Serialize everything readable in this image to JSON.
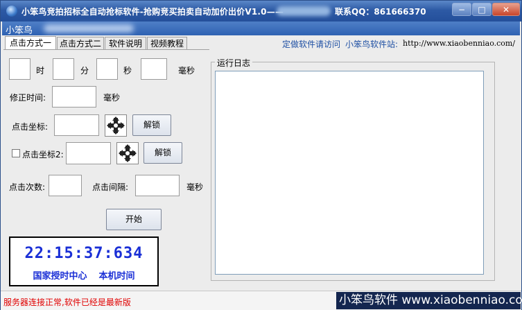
{
  "window": {
    "title": "小笨鸟竞拍招标全自动抢标软件-抢购竞买拍卖自动加价出价V1.0——",
    "title_qq": "联系QQ：861666370",
    "minimize": "−",
    "maximize": "□",
    "close": "✕"
  },
  "banner": {
    "text": "小笨鸟"
  },
  "tabs": [
    "点击方式一",
    "点击方式二",
    "软件说明",
    "视频教程"
  ],
  "links": {
    "custom": "定做软件请访问",
    "site_label": "小笨鸟软件站:",
    "site_url": "http://www.xiaobenniao.com/"
  },
  "form": {
    "time_labels": {
      "hour": "时",
      "minute": "分",
      "second": "秒",
      "millisecond": "毫秒"
    },
    "time_values": {
      "hour": "",
      "minute": "",
      "second": "",
      "millisecond": ""
    },
    "correction_label": "修正时间:",
    "correction_value": "",
    "correction_unit": "毫秒",
    "coord1_label": "点击坐标:",
    "coord1_value": "",
    "unlock1": "解锁",
    "coord2_label": "点击坐标2:",
    "coord2_value": "",
    "coord2_checked": false,
    "unlock2": "解锁",
    "count_label": "点击次数:",
    "count_value": "",
    "interval_label": "点击间隔:",
    "interval_value": "",
    "interval_unit": "毫秒",
    "start": "开始"
  },
  "clock": {
    "time": "22:15:37:634",
    "source_1": "国家授时中心",
    "source_2": "本机时间",
    "color": "#1a2fd6"
  },
  "log": {
    "title": "运行日志",
    "content": ""
  },
  "status": {
    "message": "服务器连接正常,软件已经是最新版",
    "message_color": "#e00000",
    "brand": "小笨鸟软件 www.xiaobenniao.com"
  },
  "icons": {
    "crosshair": "crosshair-move-icon",
    "app": "app-globe-icon"
  }
}
